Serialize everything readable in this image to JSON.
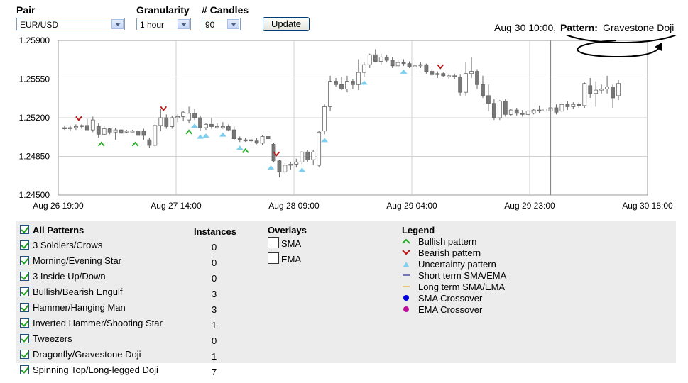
{
  "controls": {
    "pair_label": "Pair",
    "pair_value": "EUR/USD",
    "granularity_label": "Granularity",
    "granularity_value": "1 hour",
    "candles_label": "# Candles",
    "candles_value": "90",
    "update_label": "Update"
  },
  "status": {
    "time": "Aug 30 10:00,",
    "pattern_label": "Pattern:",
    "pattern_value": "Gravestone Doji"
  },
  "chart_data": {
    "type": "candlestick",
    "y_ticks": [
      "1.25900",
      "1.25550",
      "1.25200",
      "1.24850",
      "1.24500"
    ],
    "ylim": [
      1.245,
      1.259
    ],
    "x_ticks": [
      "Aug 26 19:00",
      "Aug 27 14:00",
      "Aug 28 09:00",
      "Aug 29 04:00",
      "Aug 29 23:00",
      "Aug 30 18:00"
    ],
    "grid": true,
    "candles": [
      [
        1.2511,
        1.2513,
        1.2509,
        1.251
      ],
      [
        1.251,
        1.2513,
        1.2508,
        1.2511
      ],
      [
        1.2511,
        1.2514,
        1.2509,
        1.2512
      ],
      [
        1.2512,
        1.2514,
        1.251,
        1.2513
      ],
      [
        1.2513,
        1.2519,
        1.2509,
        1.2509
      ],
      [
        1.2509,
        1.2521,
        1.2507,
        1.2518
      ],
      [
        1.2512,
        1.2515,
        1.2502,
        1.2505
      ],
      [
        1.2505,
        1.2513,
        1.2504,
        1.251
      ],
      [
        1.251,
        1.2511,
        1.2505,
        1.2507
      ],
      [
        1.2507,
        1.2511,
        1.25,
        1.2509
      ],
      [
        1.2509,
        1.251,
        1.2505,
        1.2506
      ],
      [
        1.2508,
        1.2509,
        1.2506,
        1.2508
      ],
      [
        1.2508,
        1.2509,
        1.2507,
        1.2508
      ],
      [
        1.2508,
        1.2509,
        1.2504,
        1.2504
      ],
      [
        1.2508,
        1.251,
        1.25,
        1.2504
      ],
      [
        1.25,
        1.2502,
        1.2493,
        1.2495
      ],
      [
        1.2495,
        1.2514,
        1.2494,
        1.2513
      ],
      [
        1.2513,
        1.2528,
        1.2508,
        1.252
      ],
      [
        1.252,
        1.2523,
        1.251,
        1.2512
      ],
      [
        1.2512,
        1.2522,
        1.251,
        1.252
      ],
      [
        1.252,
        1.2523,
        1.2516,
        1.2521
      ],
      [
        1.2521,
        1.2526,
        1.2517,
        1.2525
      ],
      [
        1.2518,
        1.253,
        1.2515,
        1.2524
      ],
      [
        1.2524,
        1.2528,
        1.2518,
        1.252
      ],
      [
        1.252,
        1.2522,
        1.2508,
        1.2511
      ],
      [
        1.2511,
        1.2515,
        1.2509,
        1.2514
      ],
      [
        1.2514,
        1.252,
        1.251,
        1.2512
      ],
      [
        1.2512,
        1.2515,
        1.251,
        1.2512
      ],
      [
        1.2512,
        1.2516,
        1.251,
        1.2512
      ],
      [
        1.2512,
        1.2514,
        1.2508,
        1.2509
      ],
      [
        1.2509,
        1.2512,
        1.25,
        1.2501
      ],
      [
        1.2501,
        1.2503,
        1.2498,
        1.25
      ],
      [
        1.25,
        1.2502,
        1.2498,
        1.2499
      ],
      [
        1.25,
        1.2501,
        1.2497,
        1.2499
      ],
      [
        1.2499,
        1.2502,
        1.2496,
        1.2497
      ],
      [
        1.2497,
        1.2504,
        1.2495,
        1.2503
      ],
      [
        1.2503,
        1.2504,
        1.25,
        1.2501
      ],
      [
        1.2496,
        1.2497,
        1.248,
        1.2481
      ],
      [
        1.2481,
        1.2482,
        1.2466,
        1.2471
      ],
      [
        1.2471,
        1.2479,
        1.2469,
        1.2477
      ],
      [
        1.2477,
        1.248,
        1.2473,
        1.2478
      ],
      [
        1.2478,
        1.2483,
        1.2475,
        1.248
      ],
      [
        1.248,
        1.249,
        1.2478,
        1.2489
      ],
      [
        1.2489,
        1.2491,
        1.248,
        1.2482
      ],
      [
        1.2482,
        1.2491,
        1.2477,
        1.2489
      ],
      [
        1.2477,
        1.2508,
        1.2475,
        1.2507
      ],
      [
        1.2508,
        1.2532,
        1.2505,
        1.253
      ],
      [
        1.253,
        1.2558,
        1.2526,
        1.2553
      ],
      [
        1.2553,
        1.2556,
        1.2548,
        1.255
      ],
      [
        1.255,
        1.2557,
        1.2545,
        1.2546
      ],
      [
        1.2546,
        1.2558,
        1.2543,
        1.2553
      ],
      [
        1.2553,
        1.2555,
        1.2546,
        1.255
      ],
      [
        1.255,
        1.2573,
        1.2545,
        1.2561
      ],
      [
        1.2561,
        1.257,
        1.2557,
        1.2568
      ],
      [
        1.2568,
        1.2578,
        1.2565,
        1.2577
      ],
      [
        1.2577,
        1.2582,
        1.257,
        1.2571
      ],
      [
        1.2571,
        1.2578,
        1.2568,
        1.2575
      ],
      [
        1.2575,
        1.2577,
        1.257,
        1.2572
      ],
      [
        1.2572,
        1.2575,
        1.2565,
        1.2567
      ],
      [
        1.2567,
        1.2572,
        1.2565,
        1.257
      ],
      [
        1.257,
        1.2573,
        1.2567,
        1.2569
      ],
      [
        1.2569,
        1.2571,
        1.2565,
        1.2566
      ],
      [
        1.2566,
        1.2569,
        1.2563,
        1.2567
      ],
      [
        1.2567,
        1.257,
        1.2565,
        1.2568
      ],
      [
        1.2568,
        1.2569,
        1.256,
        1.2562
      ],
      [
        1.2562,
        1.2564,
        1.2558,
        1.2559
      ],
      [
        1.2559,
        1.2562,
        1.2556,
        1.256
      ],
      [
        1.256,
        1.2561,
        1.2557,
        1.2558
      ],
      [
        1.2558,
        1.256,
        1.2555,
        1.2558
      ],
      [
        1.2558,
        1.256,
        1.2555,
        1.2557
      ],
      [
        1.2557,
        1.2559,
        1.254,
        1.2543
      ],
      [
        1.2543,
        1.257,
        1.254,
        1.256
      ],
      [
        1.256,
        1.2575,
        1.2556,
        1.2562
      ],
      [
        1.2562,
        1.2564,
        1.2546,
        1.255
      ],
      [
        1.255,
        1.2558,
        1.2538,
        1.254
      ],
      [
        1.254,
        1.255,
        1.2526,
        1.2533
      ],
      [
        1.2533,
        1.2537,
        1.2518,
        1.252
      ],
      [
        1.252,
        1.2536,
        1.2518,
        1.2535
      ],
      [
        1.2535,
        1.2537,
        1.2521,
        1.2523
      ],
      [
        1.2523,
        1.2528,
        1.2522,
        1.2527
      ],
      [
        1.2527,
        1.2529,
        1.2522,
        1.2524
      ],
      [
        1.2524,
        1.2527,
        1.2521,
        1.2523
      ],
      [
        1.2523,
        1.2527,
        1.2522,
        1.2526
      ],
      [
        1.2524,
        1.2528,
        1.2523,
        1.2527
      ],
      [
        1.2527,
        1.2531,
        1.2524,
        1.2526
      ],
      [
        1.2526,
        1.2529,
        1.2524,
        1.2528
      ],
      [
        1.2526,
        1.2531,
        1.2524,
        1.2529
      ],
      [
        1.2529,
        1.2532,
        1.2523,
        1.2525
      ],
      [
        1.2526,
        1.2534,
        1.2524,
        1.2532
      ],
      [
        1.2532,
        1.2535,
        1.2527,
        1.253
      ],
      [
        1.253,
        1.2534,
        1.2528,
        1.2532
      ],
      [
        1.2532,
        1.2534,
        1.2529,
        1.2531
      ],
      [
        1.2531,
        1.2552,
        1.2529,
        1.2551
      ],
      [
        1.2549,
        1.2556,
        1.2538,
        1.2542
      ],
      [
        1.2542,
        1.2553,
        1.253,
        1.2545
      ],
      [
        1.2545,
        1.255,
        1.2542,
        1.2546
      ],
      [
        1.2546,
        1.2558,
        1.2542,
        1.2548
      ],
      [
        1.2548,
        1.255,
        1.2529,
        1.2538
      ],
      [
        1.254,
        1.2554,
        1.2536,
        1.2551
      ]
    ],
    "markers": {
      "bullish": [
        13,
        25,
        44,
        64
      ],
      "bearish": [
        5,
        35,
        75,
        133
      ],
      "uncertainty": [
        46,
        48,
        50,
        56,
        62,
        73,
        84,
        92,
        106,
        120
      ]
    },
    "marker_colors": {
      "bullish": "#22aa22",
      "bearish": "#bb1111",
      "uncertainty": "#7ecfef"
    },
    "selected_candle_index": 86
  },
  "patterns": {
    "header_all": "All Patterns",
    "header_instances": "Instances",
    "items": [
      {
        "label": "3 Soldiers/Crows",
        "count": "0"
      },
      {
        "label": "Morning/Evening Star",
        "count": "0"
      },
      {
        "label": "3 Inside Up/Down",
        "count": "0"
      },
      {
        "label": "Bullish/Bearish Engulf",
        "count": "3"
      },
      {
        "label": "Hammer/Hanging Man",
        "count": "3"
      },
      {
        "label": "Inverted Hammer/Shooting Star",
        "count": "1"
      },
      {
        "label": "Tweezers",
        "count": "0"
      },
      {
        "label": "Dragonfly/Gravestone Doji",
        "count": "1"
      },
      {
        "label": "Spinning Top/Long-legged Doji",
        "count": "7"
      }
    ]
  },
  "overlays": {
    "title": "Overlays",
    "items": [
      {
        "label": "SMA"
      },
      {
        "label": "EMA"
      }
    ]
  },
  "legend": {
    "title": "Legend",
    "items": [
      {
        "label": "Bullish pattern",
        "icon": "bullish-marker-icon",
        "color": "#22aa22"
      },
      {
        "label": "Bearish pattern",
        "icon": "bearish-marker-icon",
        "color": "#bb1111"
      },
      {
        "label": "Uncertainty pattern",
        "icon": "uncertainty-marker-icon",
        "color": "#7ecfef"
      },
      {
        "label": "Short term SMA/EMA",
        "icon": "short-term-line-icon",
        "color": "#000080"
      },
      {
        "label": "Long term SMA/EMA",
        "icon": "long-term-line-icon",
        "color": "#e8a000"
      },
      {
        "label": "SMA Crossover",
        "icon": "sma-crossover-dot-icon",
        "color": "#0000dd"
      },
      {
        "label": "EMA Crossover",
        "icon": "ema-crossover-dot-icon",
        "color": "#bb1199"
      }
    ]
  }
}
